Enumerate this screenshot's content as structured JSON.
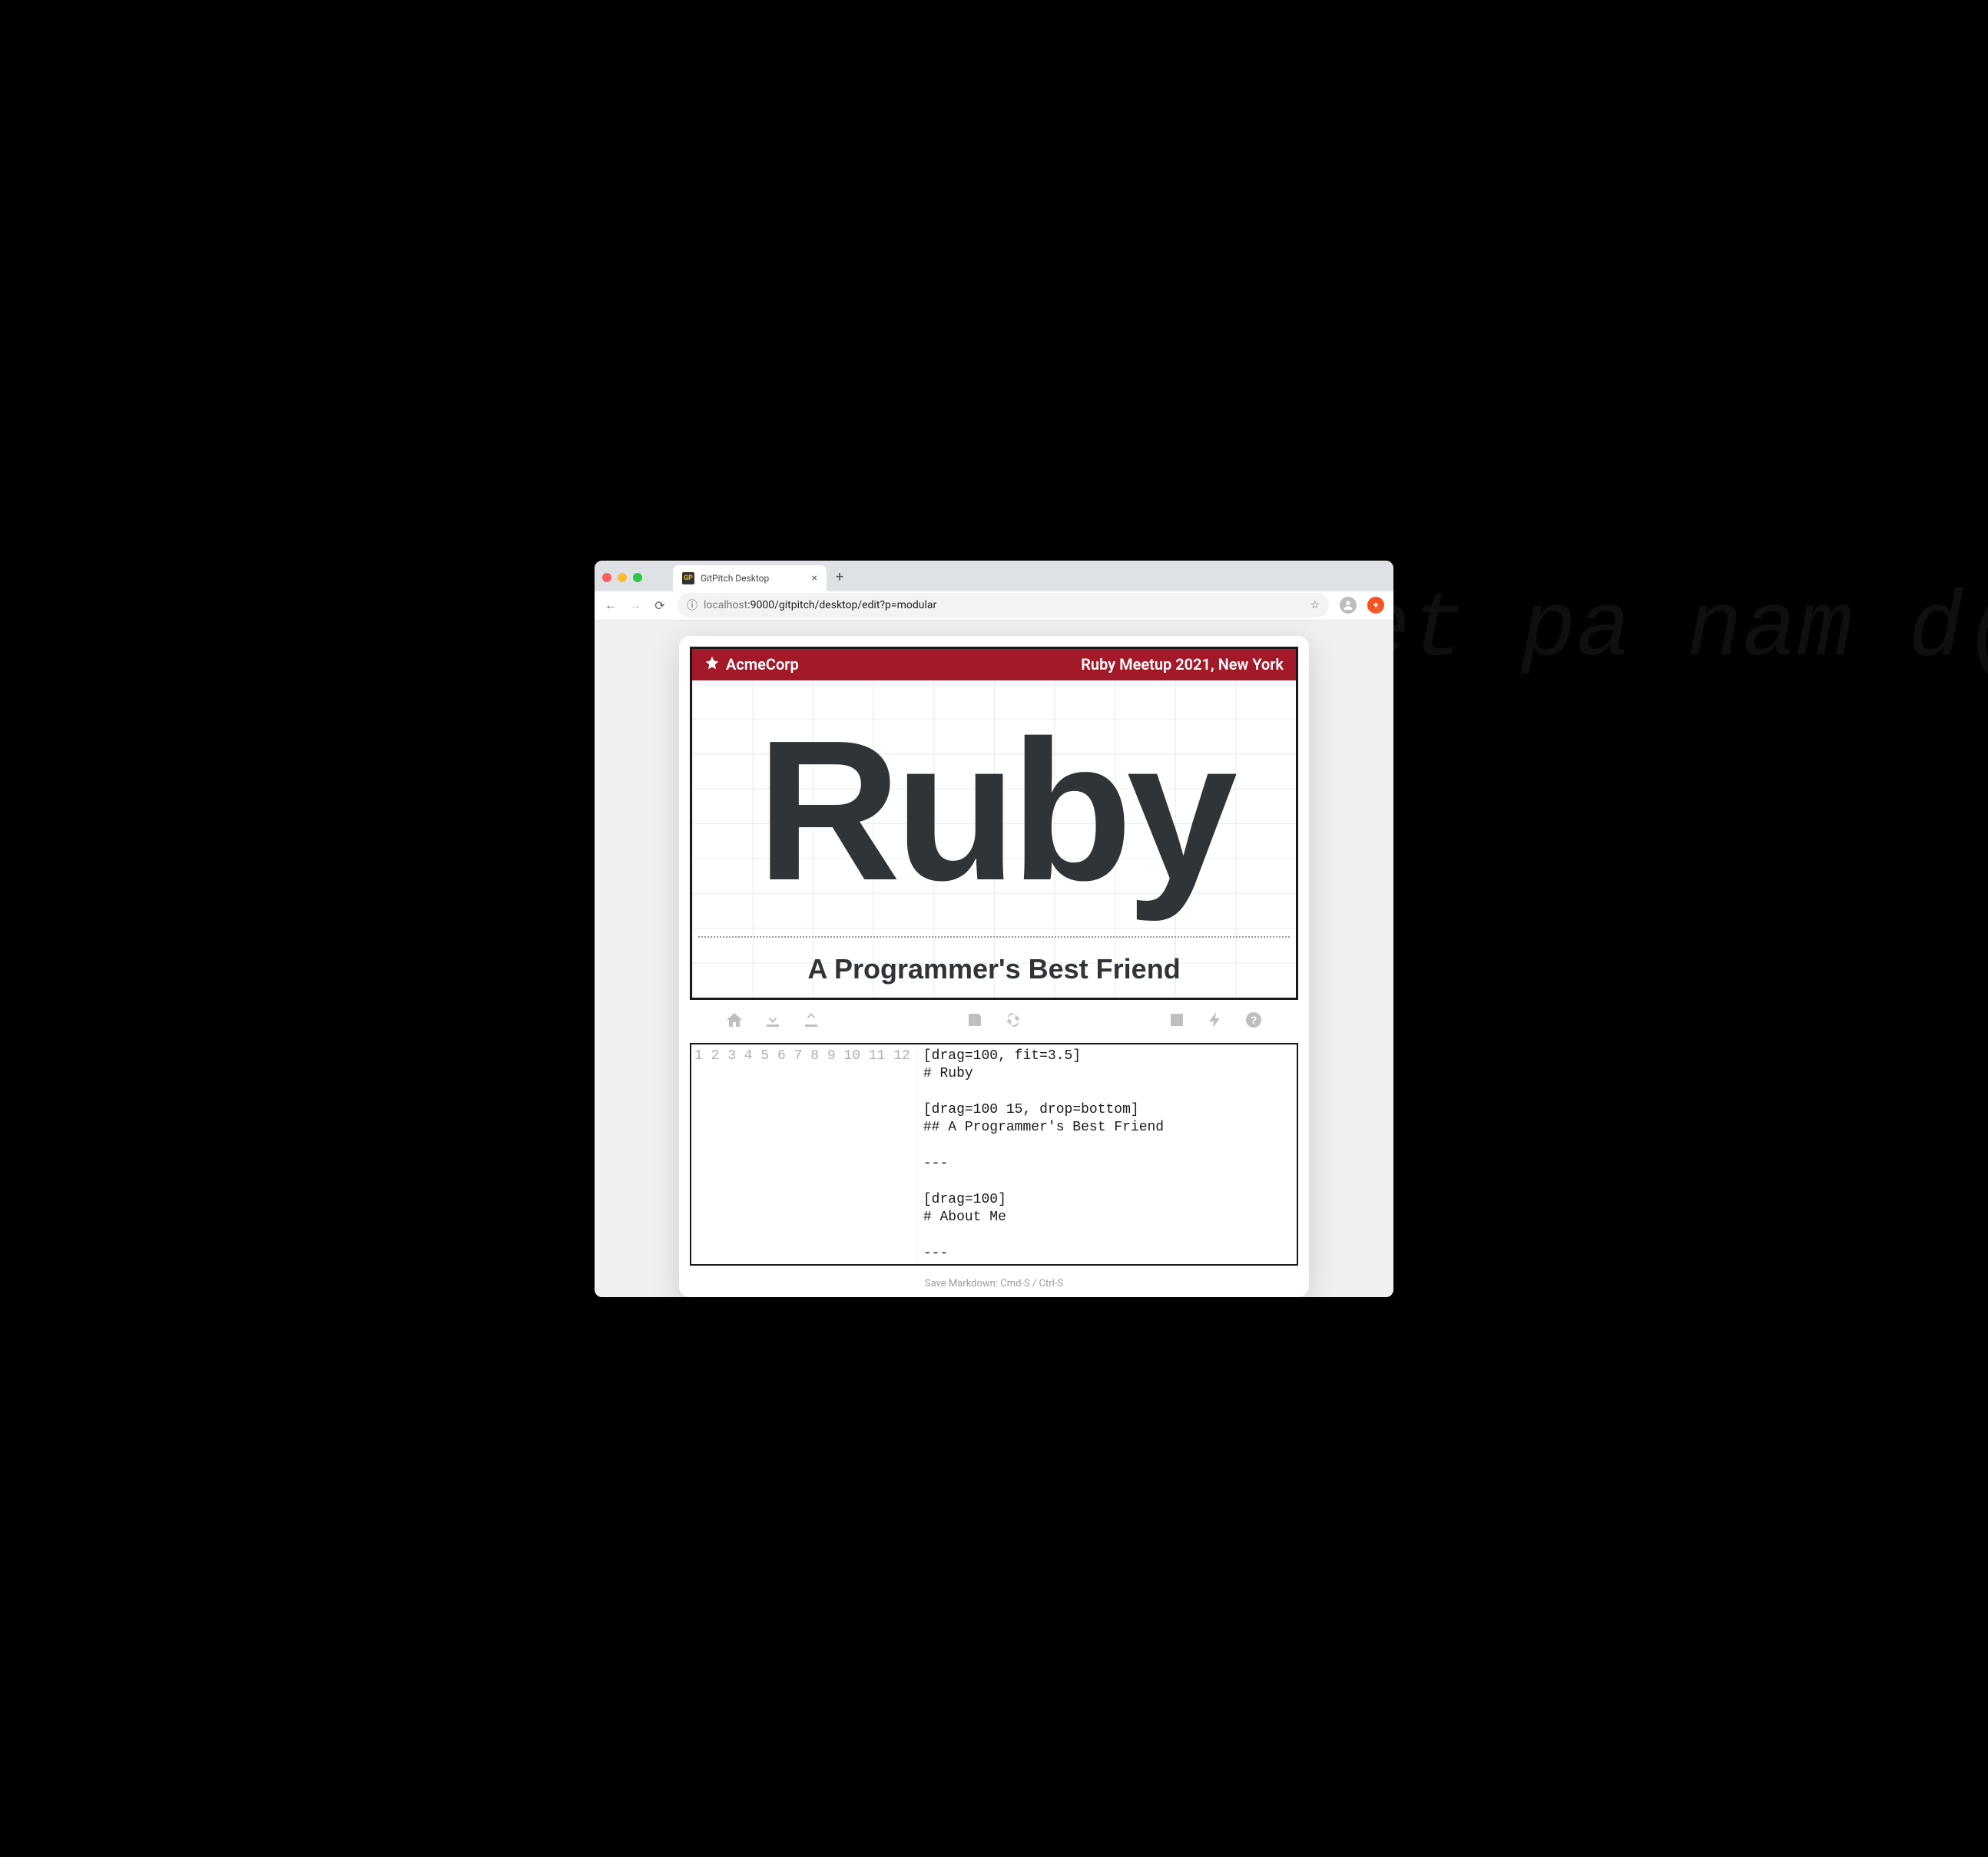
{
  "browser": {
    "tab_title": "GitPitch Desktop",
    "favicon_text": "GP",
    "url_host": "localhost",
    "url_port_path": ":9000/gitpitch/desktop/edit?p=modular"
  },
  "slide": {
    "brand": "AcmeCorp",
    "event": "Ruby Meetup 2021, New York",
    "title": "Ruby",
    "subtitle": "A Programmer's Best Friend"
  },
  "toolbar": {
    "home": "home",
    "download": "download",
    "upload": "upload",
    "save": "save",
    "refresh": "refresh",
    "image": "image",
    "bolt": "bolt",
    "help": "help"
  },
  "editor": {
    "lines": [
      "[drag=100, fit=3.5]",
      "# Ruby",
      "",
      "[drag=100 15, drop=bottom]",
      "## A Programmer's Best Friend",
      "",
      "---",
      "",
      "[drag=100]",
      "# About Me",
      "",
      "---"
    ]
  },
  "hint": "Save Markdown: Cmd-S / Ctrl-S",
  "bg_ghost": "et\n\npa\n\nnam\nd("
}
